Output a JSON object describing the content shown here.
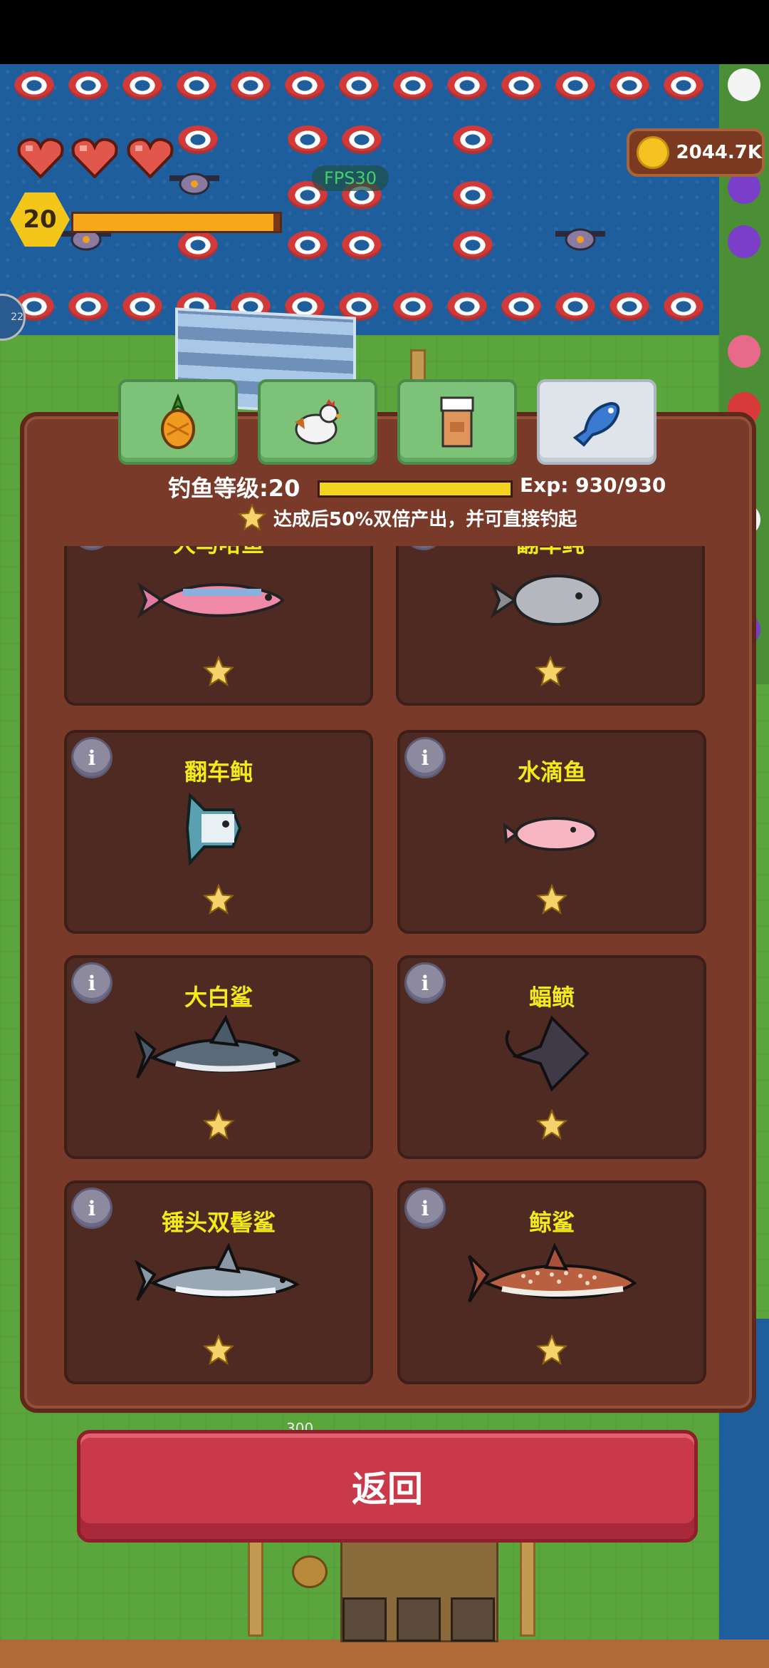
{
  "hud": {
    "fps": "FPS30",
    "player_level": "20",
    "player_xp_fraction": 0.97,
    "coins": "2044.7K",
    "side_badge": "22",
    "hearts": 3
  },
  "tabs": [
    {
      "name": "tab-farm",
      "icon": "pineapple-icon",
      "active": false
    },
    {
      "name": "tab-animals",
      "icon": "chicken-icon",
      "active": false
    },
    {
      "name": "tab-storage",
      "icon": "jar-icon",
      "active": false
    },
    {
      "name": "tab-fishing",
      "icon": "fish-icon",
      "active": true
    }
  ],
  "fishing": {
    "level_label": "钓鱼等级:20",
    "level_fraction": 1.0,
    "exp_label": "Exp: 930/930",
    "bonus_text": "达成后50%双倍产出，并可直接钓起"
  },
  "cards": [
    {
      "name": "大马哈鱼",
      "icon": "salmon-icon",
      "stars": 1,
      "partial": true
    },
    {
      "name": "翻车鲀",
      "icon": "sunfish-icon",
      "stars": 1,
      "partial": true
    },
    {
      "name": "翻车鲀",
      "icon": "sunfish-icon",
      "stars": 1
    },
    {
      "name": "水滴鱼",
      "icon": "blobfish-icon",
      "stars": 1
    },
    {
      "name": "大白鲨",
      "icon": "great-white-shark-icon",
      "stars": 1
    },
    {
      "name": "蝠鲼",
      "icon": "manta-ray-icon",
      "stars": 1
    },
    {
      "name": "锤头双髻鲨",
      "icon": "hammerhead-shark-icon",
      "stars": 1
    },
    {
      "name": "鲸鲨",
      "icon": "whale-shark-icon",
      "stars": 1
    }
  ],
  "return_button": "返回",
  "ground_number": "300",
  "colors": {
    "panel": "#7a3a2a",
    "card": "#4e2a23",
    "name_yellow": "#f3ea18",
    "return_red": "#c9394a",
    "tab_green": "#7cc278"
  }
}
